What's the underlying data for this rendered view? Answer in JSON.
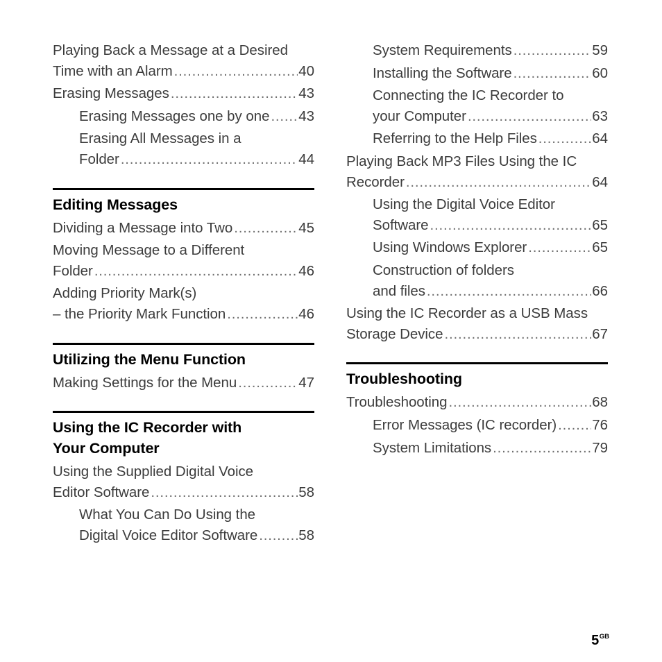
{
  "page": {
    "number": "5",
    "region_suffix": "GB"
  },
  "columns": [
    {
      "id": "left",
      "blocks": [
        {
          "type": "entries",
          "entries": [
            {
              "level": 1,
              "lines": [
                "Playing Back a Message at a Desired"
              ],
              "last_line": "Time with an Alarm",
              "page": "40"
            },
            {
              "level": 1,
              "lines": [],
              "last_line": "Erasing Messages",
              "page": "43"
            },
            {
              "level": 2,
              "lines": [],
              "last_line": "Erasing Messages one by one",
              "page": "43"
            },
            {
              "level": 2,
              "lines": [
                "Erasing All Messages in a"
              ],
              "last_line": "Folder",
              "page": "44"
            }
          ]
        },
        {
          "type": "section",
          "title": "Editing Messages",
          "entries": [
            {
              "level": 1,
              "lines": [],
              "last_line": "Dividing a Message into Two",
              "page": "45"
            },
            {
              "level": 1,
              "lines": [
                "Moving Message to a Different"
              ],
              "last_line": "Folder",
              "page": "46"
            },
            {
              "level": 1,
              "lines": [
                "Adding Priority Mark(s)"
              ],
              "last_line": "– the Priority Mark Function",
              "page": "46"
            }
          ]
        },
        {
          "type": "section",
          "title": "Utilizing the Menu Function",
          "entries": [
            {
              "level": 1,
              "lines": [],
              "last_line": "Making Settings for the Menu",
              "page": "47"
            }
          ]
        },
        {
          "type": "section",
          "title": "Using the IC Recorder with\nYour Computer",
          "entries": [
            {
              "level": 1,
              "lines": [
                "Using the Supplied Digital Voice"
              ],
              "last_line": "Editor Software",
              "page": "58"
            },
            {
              "level": 2,
              "lines": [
                "What You Can Do Using the"
              ],
              "last_line": "Digital Voice Editor Software",
              "page": "58"
            }
          ]
        }
      ]
    },
    {
      "id": "right",
      "blocks": [
        {
          "type": "entries",
          "entries": [
            {
              "level": 2,
              "lines": [],
              "last_line": "System Requirements",
              "page": "59"
            },
            {
              "level": 2,
              "lines": [],
              "last_line": "Installing the Software",
              "page": "60"
            },
            {
              "level": 2,
              "lines": [
                "Connecting the IC Recorder to"
              ],
              "last_line": "your Computer",
              "page": "63"
            },
            {
              "level": 2,
              "lines": [],
              "last_line": "Referring to the Help Files",
              "page": "64"
            },
            {
              "level": 1,
              "lines": [
                "Playing Back MP3 Files Using the IC"
              ],
              "last_line": "Recorder",
              "page": "64"
            },
            {
              "level": 2,
              "lines": [
                "Using the Digital Voice Editor"
              ],
              "last_line": "Software",
              "page": "65"
            },
            {
              "level": 2,
              "lines": [],
              "last_line": "Using Windows Explorer",
              "page": "65"
            },
            {
              "level": 2,
              "lines": [
                "Construction of folders"
              ],
              "last_line": "and files",
              "page": "66"
            },
            {
              "level": 1,
              "lines": [
                "Using the IC Recorder as a USB Mass"
              ],
              "last_line": "Storage Device",
              "page": "67"
            }
          ]
        },
        {
          "type": "section",
          "title": "Troubleshooting",
          "entries": [
            {
              "level": 1,
              "lines": [],
              "last_line": "Troubleshooting",
              "page": "68"
            },
            {
              "level": 2,
              "lines": [],
              "last_line": "Error Messages (IC recorder)",
              "page": "76"
            },
            {
              "level": 2,
              "lines": [],
              "last_line": "System Limitations",
              "page": "79"
            }
          ]
        }
      ]
    }
  ]
}
